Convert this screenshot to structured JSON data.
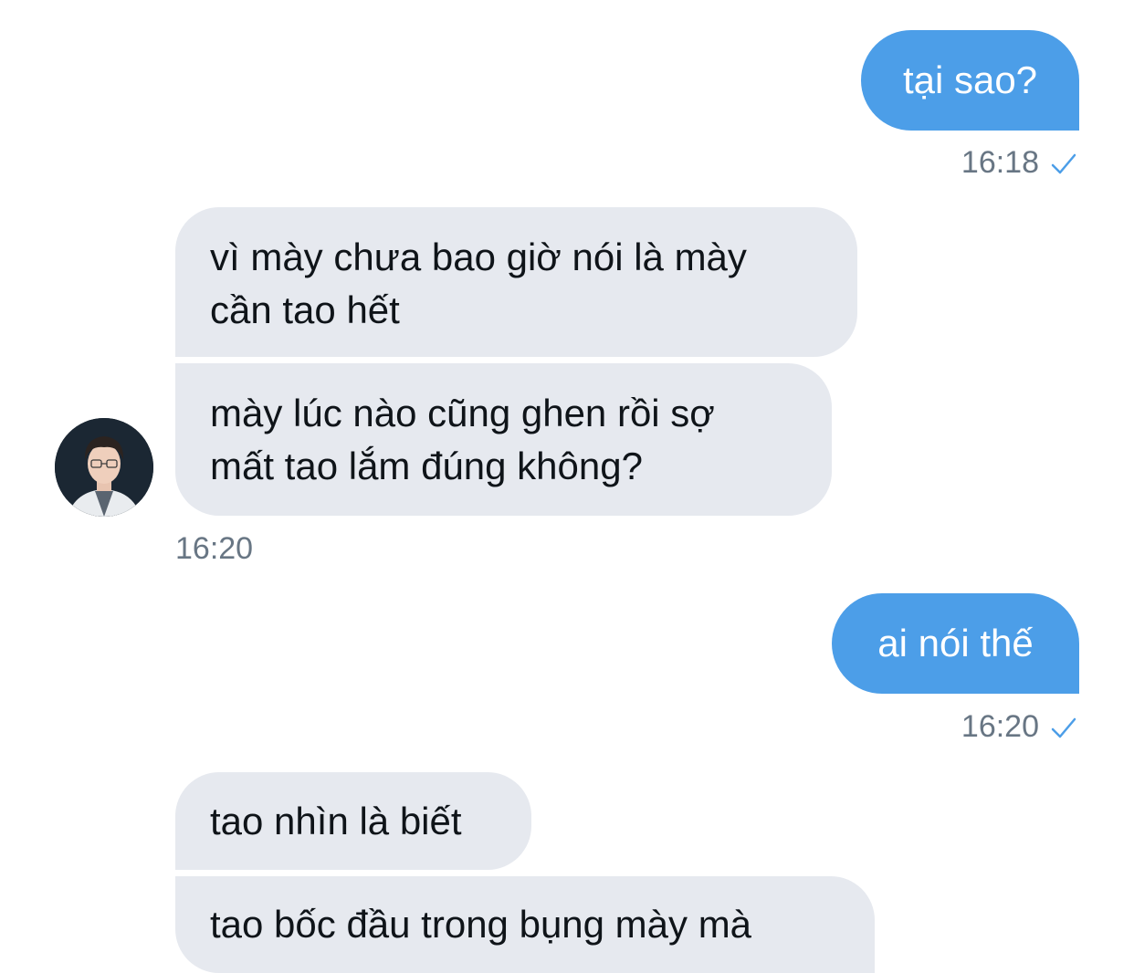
{
  "messages": [
    {
      "sender": "me",
      "text": "tại sao?",
      "time": "16:18",
      "status_icon": "check-icon"
    },
    {
      "sender": "them",
      "lines": [
        "vì mày chưa bao giờ nói là mày",
        "cần tao hết"
      ]
    },
    {
      "sender": "them",
      "lines": [
        "mày lúc nào cũng ghen rồi sợ",
        "mất tao lắm đúng không?"
      ],
      "time": "16:20"
    },
    {
      "sender": "me",
      "text": "ai nói thế",
      "time": "16:20",
      "status_icon": "check-icon"
    },
    {
      "sender": "them",
      "lines": [
        "tao nhìn là biết"
      ]
    },
    {
      "sender": "them",
      "lines": [
        "tao bốc đầu trong bụng mày mà"
      ]
    }
  ],
  "colors": {
    "sent_bubble": "#4c9ee8",
    "received_bubble": "#e6e9ef",
    "timestamp": "#687684",
    "check": "#4c9ee8"
  }
}
